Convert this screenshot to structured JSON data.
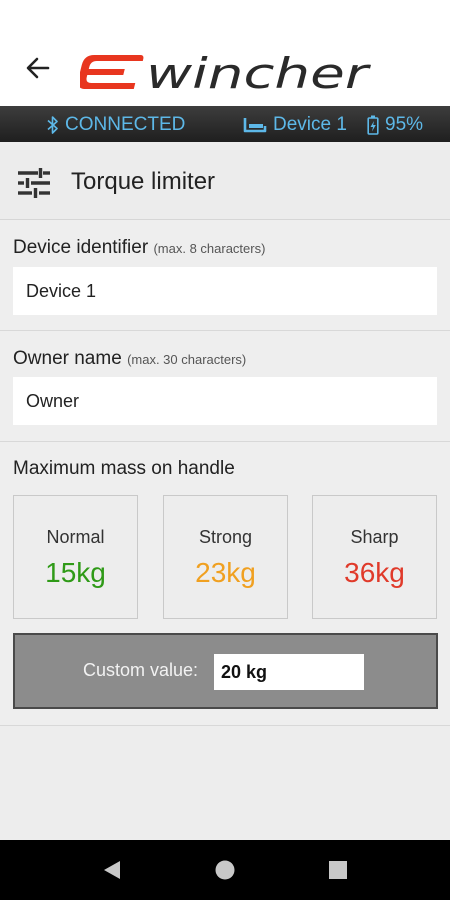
{
  "header": {
    "logo_text": "ewincher"
  },
  "status_bar": {
    "connection": "CONNECTED",
    "device": "Device 1",
    "battery": "95%"
  },
  "page": {
    "title": "Torque limiter"
  },
  "device_identifier": {
    "label": "Device identifier",
    "hint": "(max. 8 characters)",
    "value": "Device 1"
  },
  "owner_name": {
    "label": "Owner name",
    "hint": "(max. 30 characters)",
    "value": "Owner"
  },
  "max_mass": {
    "label": "Maximum mass on handle",
    "presets": [
      {
        "name": "Normal",
        "value": "15kg",
        "color": "#2f9a17"
      },
      {
        "name": "Strong",
        "value": "23kg",
        "color": "#f0a020"
      },
      {
        "name": "Sharp",
        "value": "36kg",
        "color": "#e03a2a"
      }
    ],
    "custom_label": "Custom value:",
    "custom_value": "20 kg"
  },
  "colors": {
    "status_text": "#5db8e8",
    "logo_red": "#e8361f",
    "logo_dark": "#2a2a2a"
  }
}
